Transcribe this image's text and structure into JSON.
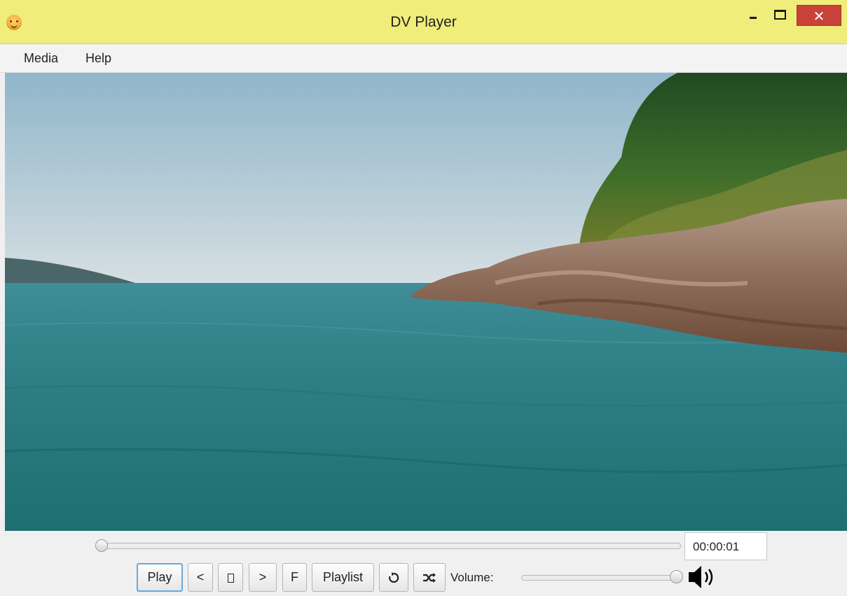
{
  "window": {
    "title": "DV Player"
  },
  "menu": {
    "items": [
      "Media",
      "Help"
    ]
  },
  "player": {
    "time": "00:00:01",
    "seek_fraction": 0.0,
    "volume_fraction": 1.0
  },
  "controls": {
    "play_label": "Play",
    "prev_label": "<",
    "next_label": ">",
    "fullscreen_label": "F",
    "playlist_label": "Playlist",
    "volume_label": "Volume:"
  },
  "colors": {
    "titlebar": "#f1ed7a",
    "close_button": "#c9423a",
    "focus_ring": "#6aa9d8"
  },
  "icons": {
    "app": "app-icon",
    "stop": "stop-icon",
    "repeat": "repeat-icon",
    "shuffle": "shuffle-icon",
    "speaker": "speaker-icon"
  }
}
